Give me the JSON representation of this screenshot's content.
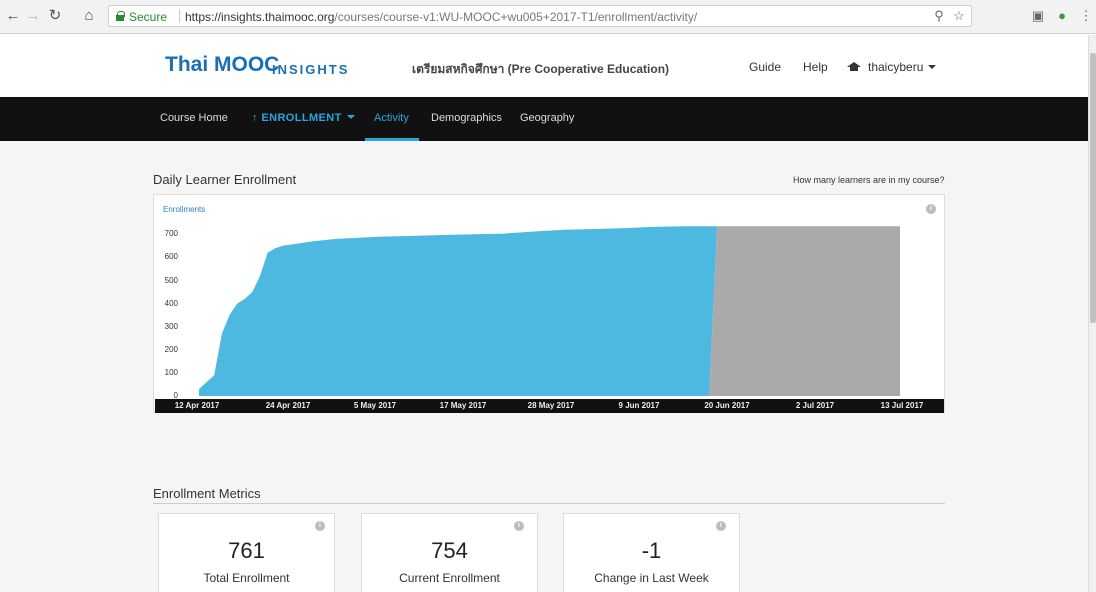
{
  "browser": {
    "secure_label": "Secure",
    "url_host": "https://insights.thaimooc.org",
    "url_path": "/courses/course-v1:WU-MOOC+wu005+2017-T1/enrollment/activity/",
    "icons": [
      "back-arrow-icon",
      "forward-arrow-icon",
      "reload-icon",
      "home-icon",
      "zoom-icon",
      "star-icon",
      "extension-icon",
      "profile-icon",
      "menu-icon"
    ]
  },
  "header": {
    "brand": "Thai MOOC",
    "brand_sub": "INSIGHTS",
    "course_name": "เตรียมสหกิจศึกษา (Pre Cooperative Education)",
    "guide": "Guide",
    "help": "Help",
    "user": "thaicyberu"
  },
  "nav": {
    "course_home": "Course Home",
    "enrollment": "ENROLLMENT",
    "activity": "Activity",
    "demographics": "Demographics",
    "geography": "Geography"
  },
  "chart_section": {
    "title": "Daily Learner Enrollment",
    "help_link": "How many learners are in my course?"
  },
  "chart_data": {
    "type": "area",
    "ylabel": "Enrollments",
    "ylim": [
      0,
      750
    ],
    "yticks": [
      "0",
      "100",
      "200",
      "300",
      "400",
      "500",
      "600",
      "700"
    ],
    "xtick_labels": [
      "12 Apr 2017",
      "24 Apr 2017",
      "5 May 2017",
      "17 May 2017",
      "28 May 2017",
      "9 Jun 2017",
      "20 Jun 2017",
      "2 Jul 2017",
      "13 Jul 2017"
    ],
    "series": [
      {
        "color": "#4db8e0",
        "x": [
          "2017-04-12",
          "2017-04-14",
          "2017-04-15",
          "2017-04-16",
          "2017-04-17",
          "2017-04-18",
          "2017-04-19",
          "2017-04-20",
          "2017-04-21",
          "2017-04-22",
          "2017-04-23",
          "2017-04-25",
          "2017-04-27",
          "2017-04-30",
          "2017-05-03",
          "2017-05-06",
          "2017-05-10",
          "2017-05-14",
          "2017-05-18",
          "2017-05-22",
          "2017-05-26",
          "2017-05-30",
          "2017-06-03",
          "2017-06-07",
          "2017-06-11",
          "2017-06-15",
          "2017-06-19"
        ],
        "values": [
          30,
          90,
          270,
          350,
          400,
          420,
          450,
          520,
          620,
          640,
          650,
          660,
          670,
          680,
          685,
          690,
          693,
          697,
          700,
          703,
          712,
          720,
          723,
          727,
          733,
          735,
          735
        ]
      },
      {
        "color": "#aaaaaa",
        "x": [
          "2017-06-19",
          "2017-07-13"
        ],
        "values": [
          735,
          735
        ]
      }
    ]
  },
  "metrics": {
    "title": "Enrollment Metrics",
    "tiles": [
      {
        "value": "761",
        "label": "Total Enrollment"
      },
      {
        "value": "754",
        "label": "Current Enrollment"
      },
      {
        "value": "-1",
        "label": "Change in Last Week"
      }
    ]
  }
}
